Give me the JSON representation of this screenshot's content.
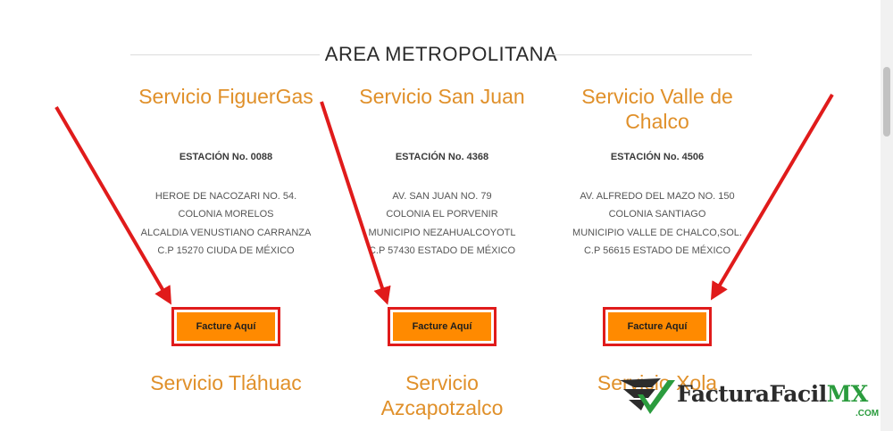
{
  "section": {
    "title": "AREA METROPOLITANA"
  },
  "stations": [
    {
      "name": "Servicio FiguerGas",
      "station": "ESTACIÓN No. 0088",
      "address": [
        "HEROE DE NACOZARI NO. 54.",
        "COLONIA MORELOS",
        "ALCALDIA VENUSTIANO CARRANZA",
        "C.P 15270 CIUDA DE MÉXICO"
      ],
      "button": "Facture Aquí"
    },
    {
      "name": "Servicio San Juan",
      "station": "ESTACIÓN No. 4368",
      "address": [
        "AV. SAN JUAN NO. 79",
        "COLONIA EL PORVENIR",
        "MUNICIPIO NEZAHUALCOYOTL",
        "C.P 57430 ESTADO DE MÉXICO"
      ],
      "button": "Facture Aquí"
    },
    {
      "name": "Servicio Valle de Chalco",
      "station": "ESTACIÓN No. 4506",
      "address": [
        "AV. ALFREDO DEL MAZO NO. 150",
        "COLONIA SANTIAGO",
        "MUNICIPIO VALLE DE CHALCO,SOL.",
        "C.P 56615 ESTADO DE MÉXICO"
      ],
      "button": "Facture Aquí"
    }
  ],
  "next_stations": [
    "Servicio Tláhuac",
    "Servicio Azcapotzalco",
    "Servicio Xola"
  ],
  "watermark": {
    "brand": "FacturaFacil",
    "suffix": "MX",
    "domain": ".COM"
  },
  "colors": {
    "accent": "#e0902a",
    "button": "#ff8a00",
    "highlight": "#e01b1b",
    "brand_green": "#2b9c3e"
  }
}
